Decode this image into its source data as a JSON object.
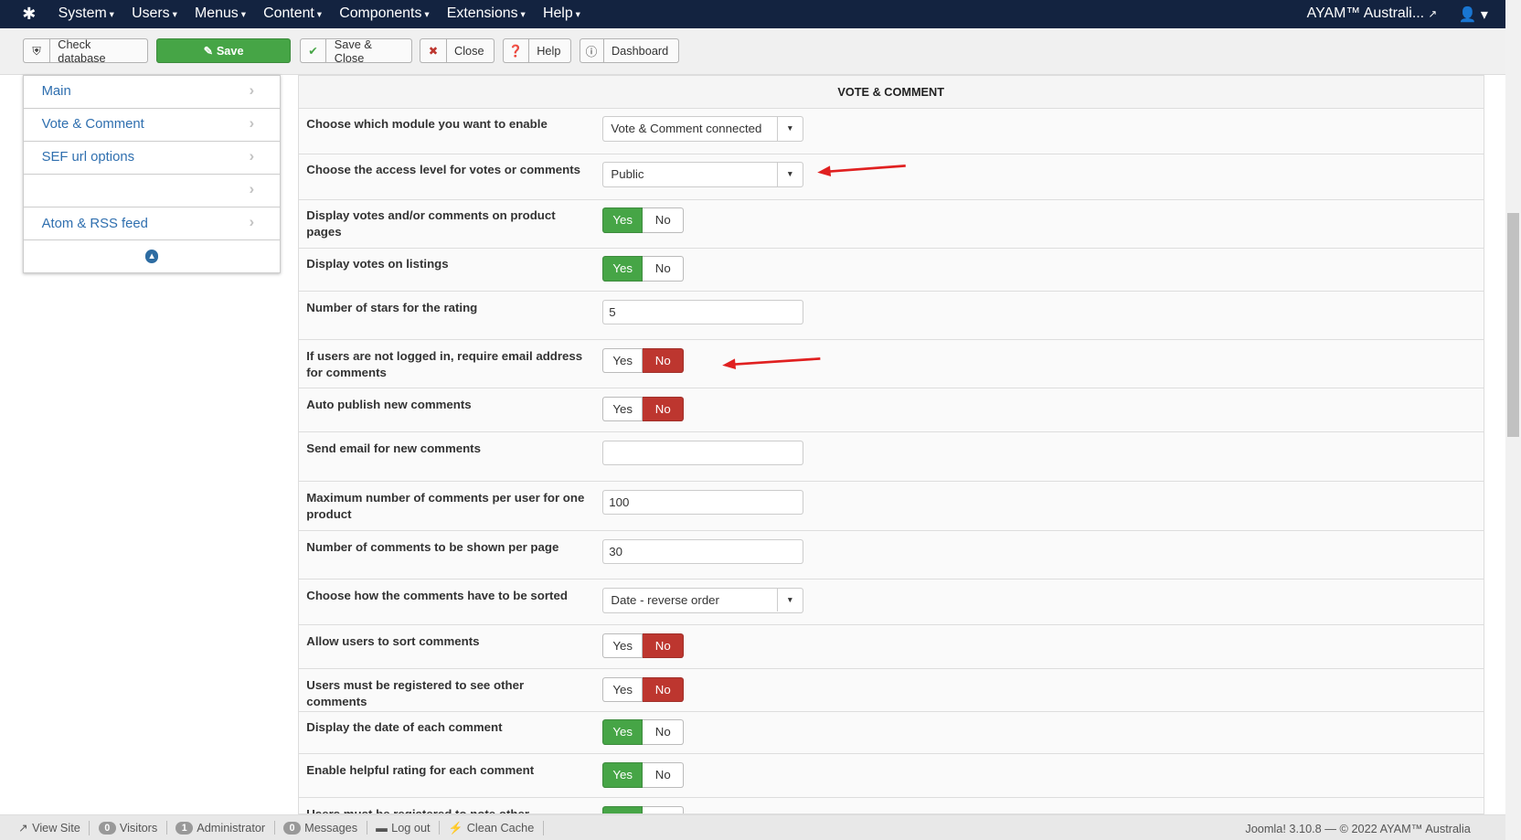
{
  "nav": {
    "menus": [
      "System",
      "Users",
      "Menus",
      "Content",
      "Components",
      "Extensions",
      "Help"
    ],
    "site": "AYAM™ Australi...",
    "logo": "joomla-logo"
  },
  "toolbar": {
    "check_database": "Check database",
    "save": "Save",
    "save_close": "Save & Close",
    "close": "Close",
    "help": "Help",
    "dashboard": "Dashboard"
  },
  "sidebar": {
    "items": [
      "Main",
      "Vote & Comment",
      "SEF url options",
      "",
      "Atom & RSS feed"
    ]
  },
  "panel": {
    "title": "VOTE & COMMENT",
    "rows": [
      {
        "label": "Choose which module you want to enable",
        "type": "select",
        "value": "Vote & Comment connected"
      },
      {
        "label": "Choose the access level for votes or comments",
        "type": "select",
        "value": "Public",
        "arrow": true
      },
      {
        "label": "Display votes and/or comments on product pages",
        "type": "yn",
        "value": "Yes"
      },
      {
        "label": "Display votes on listings",
        "type": "yn",
        "value": "Yes"
      },
      {
        "label": "Number of stars for the rating",
        "type": "input",
        "value": "5"
      },
      {
        "label": "If users are not logged in, require email address for comments",
        "type": "yn",
        "value": "No",
        "arrow": true
      },
      {
        "label": "Auto publish new comments",
        "type": "yn",
        "value": "No"
      },
      {
        "label": "Send email for new comments",
        "type": "input",
        "value": ""
      },
      {
        "label": "Maximum number of comments per user for one product",
        "type": "input",
        "value": "100"
      },
      {
        "label": "Number of comments to be shown per page",
        "type": "input",
        "value": "30"
      },
      {
        "label": "Choose how the comments have to be sorted",
        "type": "select",
        "value": "Date - reverse order"
      },
      {
        "label": "Allow users to sort comments",
        "type": "yn",
        "value": "No"
      },
      {
        "label": "Users must be registered to see other comments",
        "type": "yn",
        "value": "No"
      },
      {
        "label": "Display the date of each comment",
        "type": "yn",
        "value": "Yes"
      },
      {
        "label": "Enable helpful rating for each comment",
        "type": "yn",
        "value": "Yes"
      },
      {
        "label": "Users must be registered to note other comments",
        "type": "yn",
        "value": "Yes"
      }
    ],
    "yes": "Yes",
    "no": "No"
  },
  "footer": {
    "view_site": "View Site",
    "visitors_count": "0",
    "visitors": "Visitors",
    "admin_count": "1",
    "admin": "Administrator",
    "messages_count": "0",
    "messages": "Messages",
    "logout": "Log out",
    "clean_cache": "Clean Cache",
    "copyright": "Joomla! 3.10.8 — © 2022 AYAM™ Australia"
  },
  "colors": {
    "navbar": "#132340",
    "yes": "#46a546",
    "no": "#bd362f",
    "link": "#2f6faf",
    "annotation_arrow": "#e02020"
  }
}
